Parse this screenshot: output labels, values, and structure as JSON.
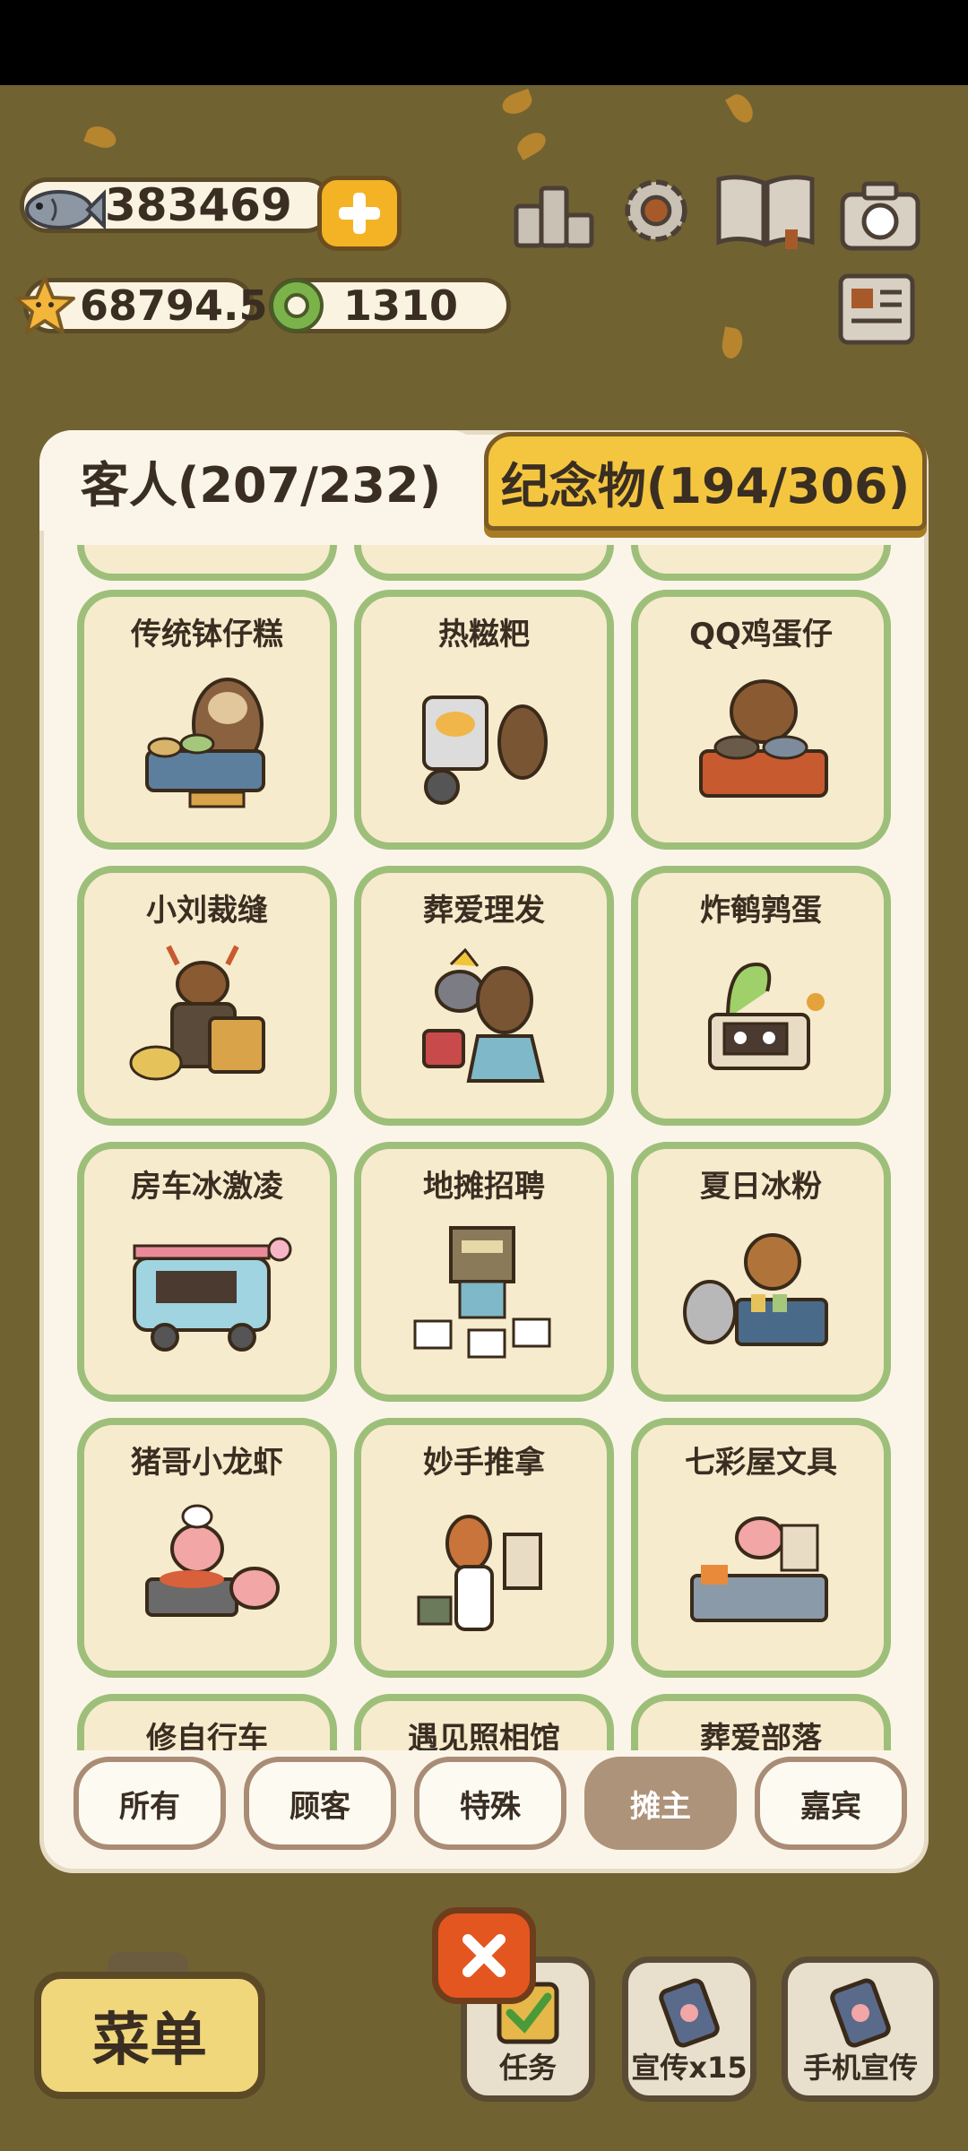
{
  "currency": {
    "fish": "383469",
    "star": "68794.5",
    "ring": "1310"
  },
  "tabs": {
    "guests": "客人(207/232)",
    "souvenirs": "纪念物(194/306)"
  },
  "cards": [
    {
      "name": "传统钵仔糕"
    },
    {
      "name": "热糍粑"
    },
    {
      "name": "QQ鸡蛋仔"
    },
    {
      "name": "小刘裁缝"
    },
    {
      "name": "葬爱理发"
    },
    {
      "name": "炸鹌鹑蛋"
    },
    {
      "name": "房车冰激凌"
    },
    {
      "name": "地摊招聘"
    },
    {
      "name": "夏日冰粉"
    },
    {
      "name": "猪哥小龙虾"
    },
    {
      "name": "妙手推拿"
    },
    {
      "name": "七彩屋文具"
    },
    {
      "name": "修自行车"
    },
    {
      "name": "遇见照相馆"
    },
    {
      "name": "葬爱部落"
    }
  ],
  "filters": [
    "所有",
    "顾客",
    "特殊",
    "摊主",
    "嘉宾"
  ],
  "active_filter": "摊主",
  "bottom": {
    "menu": "菜单",
    "tasks": "任务",
    "promote": "宣传x15",
    "phone_promote": "手机宣传"
  },
  "colors": {
    "card_border": "#9dbf7a",
    "card_bg": "#f7ebcd",
    "active_tab": "#f4c640",
    "active_filter": "#ad9379"
  },
  "icons": [
    "fish-icon",
    "plus-icon",
    "star-icon",
    "ring-icon",
    "leaderboard-icon",
    "gear-icon",
    "book-icon",
    "camera-icon",
    "newspaper-icon",
    "close-icon",
    "check-icon",
    "phone-icon"
  ]
}
